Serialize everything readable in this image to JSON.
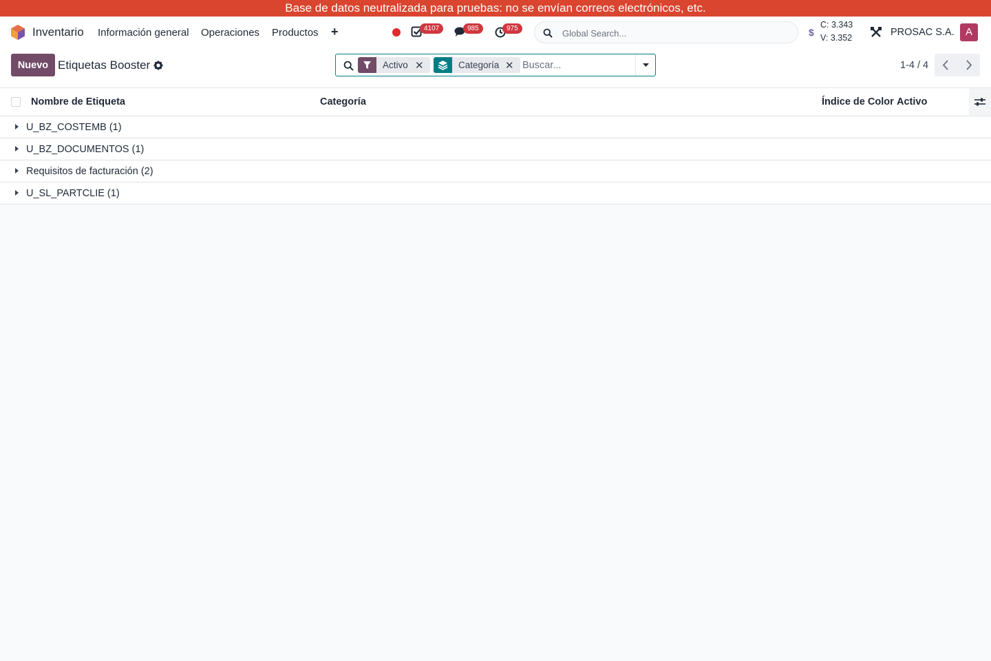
{
  "banner": {
    "text": "Base de datos neutralizada para pruebas: no se envían correos electrónicos, etc."
  },
  "navbar": {
    "app_name": "Inventario",
    "menu": [
      "Información general",
      "Operaciones",
      "Productos"
    ],
    "badges": {
      "activities": "4107",
      "messages": "985",
      "timesheets": "975"
    },
    "global_search_placeholder": "Global Search...",
    "currency": {
      "symbol": "$",
      "buy": "C: 3.343",
      "sell": "V: 3.352"
    },
    "company": "PROSAC S.A.",
    "avatar_letter": "A"
  },
  "control_panel": {
    "new_button": "Nuevo",
    "title": "Etiquetas Booster",
    "facets": [
      {
        "label": "Activo",
        "icon": "filter-icon",
        "icon_color": "#714b67"
      },
      {
        "label": "Categoría",
        "icon": "group-by-icon",
        "icon_color": "#017e84"
      }
    ],
    "search_placeholder": "Buscar...",
    "pager": "1-4 / 4"
  },
  "list": {
    "columns": {
      "name": "Nombre de Etiqueta",
      "category": "Categoría",
      "color_index": "Índice de Color",
      "active": "Activo"
    },
    "groups": [
      {
        "label": "U_BZ_COSTEMB (1)"
      },
      {
        "label": "U_BZ_DOCUMENTOS (1)"
      },
      {
        "label": "Requisitos de facturación (2)"
      },
      {
        "label": "U_SL_PARTCLIE (1)"
      }
    ]
  },
  "colors": {
    "banner": "#d9452f",
    "primary": "#714b67",
    "accent": "#017e84",
    "badge": "#d0373f",
    "avatar": "#b13a63"
  }
}
